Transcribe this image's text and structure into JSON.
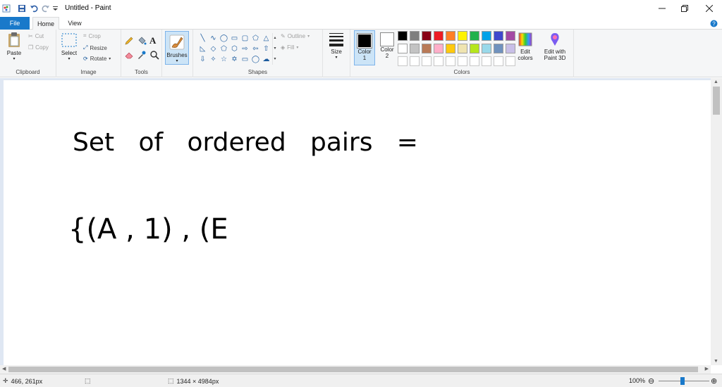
{
  "window": {
    "title": "Untitled - Paint"
  },
  "tabs": {
    "file": "File",
    "home": "Home",
    "view": "View"
  },
  "clipboard": {
    "paste": "Paste",
    "cut": "Cut",
    "copy": "Copy",
    "label": "Clipboard"
  },
  "image": {
    "select": "Select",
    "crop": "Crop",
    "resize": "Resize",
    "rotate": "Rotate",
    "label": "Image"
  },
  "tools": {
    "label": "Tools"
  },
  "brushes": {
    "label": "Brushes"
  },
  "shapes": {
    "outline": "Outline",
    "fill": "Fill",
    "label": "Shapes"
  },
  "size": {
    "label": "Size"
  },
  "colors": {
    "color1_line1": "Color",
    "color1_line2": "1",
    "color2_line1": "Color",
    "color2_line2": "2",
    "edit_line1": "Edit",
    "edit_line2": "colors",
    "paint3d_line1": "Edit with",
    "paint3d_line2": "Paint 3D",
    "label": "Colors",
    "color1_value": "#000000",
    "color2_value": "#ffffff",
    "palette": [
      "#000000",
      "#7f7f7f",
      "#880015",
      "#ed1c24",
      "#ff7f27",
      "#fff200",
      "#22b14c",
      "#00a2e8",
      "#3f48cc",
      "#a349a4",
      "#ffffff",
      "#c3c3c3",
      "#b97a57",
      "#ffaec9",
      "#ffc90e",
      "#efe4b0",
      "#b5e61d",
      "#99d9ea",
      "#7092be",
      "#c8bfe7",
      "#ffffff",
      "#ffffff",
      "#ffffff",
      "#ffffff",
      "#ffffff",
      "#ffffff",
      "#ffffff",
      "#ffffff",
      "#ffffff",
      "#ffffff"
    ]
  },
  "canvas": {
    "line1": "Set   of   ordered   pairs   =",
    "line2": "{(A , 1) , (E"
  },
  "status": {
    "cursor": "466, 261px",
    "canvas_size": "1344 × 4984px",
    "zoom": "100%"
  }
}
